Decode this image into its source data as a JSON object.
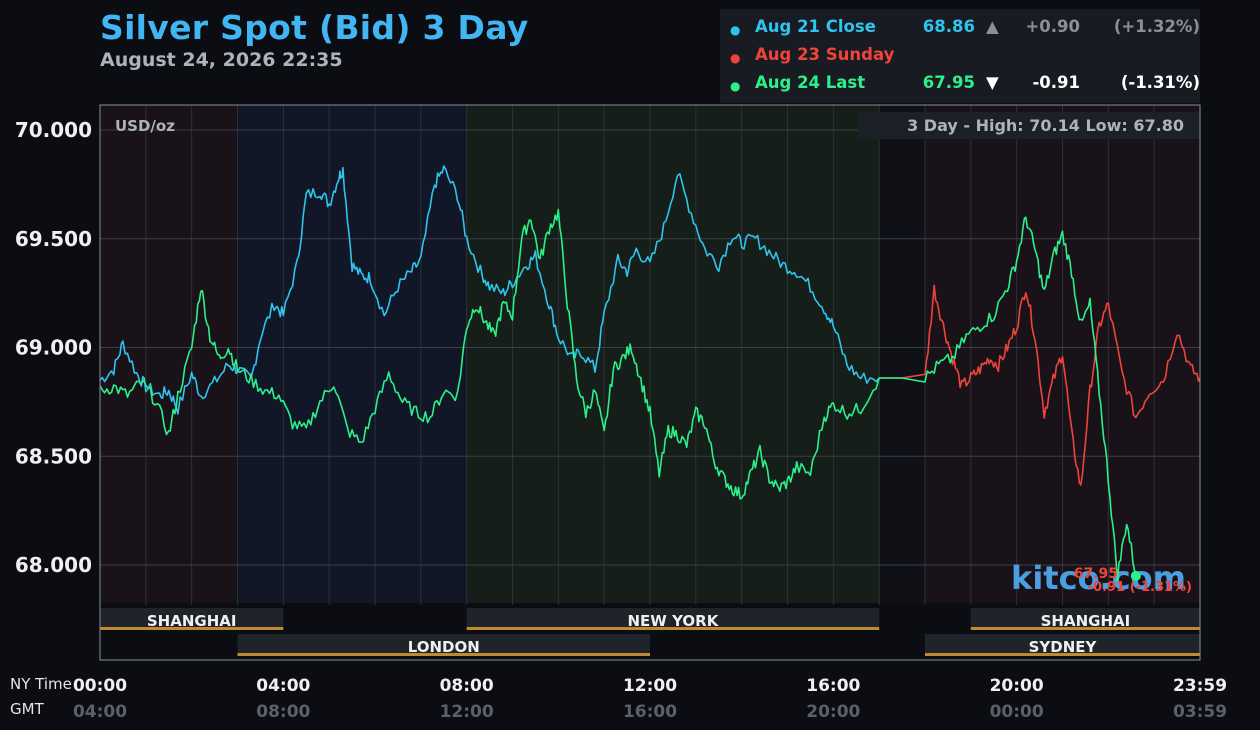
{
  "header": {
    "title": "Silver Spot (Bid) 3 Day",
    "timestamp": "August 24, 2026 22:35"
  },
  "legend": [
    {
      "label": "Aug 21 Close",
      "value": "68.86",
      "arrow": "▲",
      "change": "+0.90",
      "percent": "(+1.32%)",
      "color": "#2ec4ee"
    },
    {
      "label": "Aug 23 Sunday",
      "value": "",
      "arrow": "",
      "change": "",
      "percent": "",
      "color": "#f0443a"
    },
    {
      "label": "Aug 24 Last",
      "value": "67.95",
      "arrow": "▼",
      "change": "-0.91",
      "percent": "(-1.31%)",
      "color": "#2cf08a"
    }
  ],
  "chart": {
    "unit_label": "USD/oz",
    "range_label": "3 Day - High: 70.14  Low: 67.80",
    "watermark": "kitco.com",
    "last_value_label": "67.95",
    "last_change_label": "-0.91 (-1.31%)",
    "time_axis_label_ny": "NY Time",
    "time_axis_label_gmt": "GMT"
  },
  "chart_data": {
    "type": "line",
    "title": "Silver Spot (Bid) 3 Day",
    "ylabel": "USD/oz",
    "ylim": [
      67.8,
      70.2
    ],
    "y_ticks": [
      70.0,
      69.5,
      69.0,
      68.5,
      68.0
    ],
    "y_tick_labels": [
      "70.000",
      "69.500",
      "69.000",
      "68.500",
      "68.000"
    ],
    "x_range_hours": [
      0,
      24
    ],
    "x_ticks": [
      {
        "hour": 0,
        "ny": "00:00",
        "gmt": "04:00"
      },
      {
        "hour": 4,
        "ny": "04:00",
        "gmt": "08:00"
      },
      {
        "hour": 8,
        "ny": "08:00",
        "gmt": "12:00"
      },
      {
        "hour": 12,
        "ny": "12:00",
        "gmt": "16:00"
      },
      {
        "hour": 16,
        "ny": "16:00",
        "gmt": "20:00"
      },
      {
        "hour": 20,
        "ny": "20:00",
        "gmt": "00:00"
      },
      {
        "hour": 24,
        "ny": "23:59",
        "gmt": "03:59"
      }
    ],
    "sessions": [
      {
        "name": "SHANGHAI",
        "start": 0,
        "end": 4,
        "row": 1
      },
      {
        "name": "NEW YORK",
        "start": 8,
        "end": 17,
        "row": 1
      },
      {
        "name": "SHANGHAI",
        "start": 19,
        "end": 24,
        "row": 1
      },
      {
        "name": "LONDON",
        "start": 3,
        "end": 12,
        "row": 2
      },
      {
        "name": "SYDNEY",
        "start": 18,
        "end": 24,
        "row": 2
      }
    ],
    "grid": true,
    "series": [
      {
        "name": "Aug 21 Close",
        "color": "#2ec4ee",
        "x": [
          0,
          0.3,
          0.5,
          0.8,
          1.0,
          1.3,
          1.5,
          1.7,
          2.0,
          2.2,
          2.5,
          2.8,
          3.0,
          3.3,
          3.5,
          3.8,
          4.0,
          4.3,
          4.5,
          4.8,
          5.0,
          5.2,
          5.3,
          5.5,
          5.7,
          5.9,
          6.2,
          6.5,
          6.8,
          7.0,
          7.3,
          7.5,
          7.8,
          8.0,
          8.3,
          8.5,
          8.8,
          9.0,
          9.3,
          9.5,
          9.8,
          10.0,
          10.3,
          10.5,
          10.8,
          11.0,
          11.3,
          11.5,
          11.7,
          12.0,
          12.3,
          12.6,
          12.9,
          13.2,
          13.5,
          13.8,
          14.0,
          14.3,
          14.6,
          14.9,
          15.2,
          15.5,
          15.8,
          16.0,
          16.3,
          16.6,
          17.0
        ],
        "values": [
          68.85,
          68.9,
          69.02,
          68.88,
          68.82,
          68.78,
          68.8,
          68.72,
          68.88,
          68.78,
          68.84,
          68.92,
          68.9,
          68.85,
          69.05,
          69.2,
          69.15,
          69.38,
          69.7,
          69.72,
          69.66,
          69.78,
          69.82,
          69.38,
          69.33,
          69.32,
          69.15,
          69.28,
          69.35,
          69.4,
          69.75,
          69.82,
          69.7,
          69.5,
          69.35,
          69.28,
          69.25,
          69.3,
          69.38,
          69.42,
          69.2,
          69.05,
          68.95,
          68.98,
          68.9,
          69.15,
          69.4,
          69.35,
          69.45,
          69.38,
          69.55,
          69.8,
          69.62,
          69.45,
          69.38,
          69.52,
          69.48,
          69.5,
          69.44,
          69.38,
          69.35,
          69.28,
          69.18,
          69.1,
          68.92,
          68.86,
          68.86
        ]
      },
      {
        "name": "Aug 23 Sunday",
        "color": "#f0443a",
        "x": [
          17.0,
          18.0,
          18.2,
          18.4,
          18.6,
          18.8,
          19.0,
          19.2,
          19.4,
          19.6,
          19.8,
          20.0,
          20.2,
          20.4,
          20.6,
          20.8,
          21.0,
          21.2,
          21.4,
          21.6,
          21.8,
          22.0,
          22.3,
          22.6,
          22.9,
          23.2,
          23.5,
          23.8,
          24.0
        ],
        "values": [
          68.86,
          68.86,
          69.27,
          69.1,
          68.95,
          68.82,
          68.86,
          68.9,
          68.95,
          68.92,
          69.0,
          69.1,
          69.28,
          69.05,
          68.7,
          68.85,
          68.98,
          68.6,
          68.35,
          68.8,
          69.1,
          69.2,
          68.88,
          68.68,
          68.8,
          68.85,
          69.08,
          68.9,
          68.86
        ]
      },
      {
        "name": "Aug 24 Last",
        "color": "#2cf08a",
        "x": [
          0,
          0.3,
          0.6,
          0.9,
          1.2,
          1.5,
          1.7,
          2.0,
          2.2,
          2.4,
          2.6,
          2.8,
          3.0,
          3.3,
          3.6,
          3.9,
          4.2,
          4.5,
          4.8,
          5.1,
          5.4,
          5.7,
          6.0,
          6.3,
          6.6,
          6.9,
          7.2,
          7.5,
          7.8,
          8.0,
          8.2,
          8.4,
          8.6,
          8.8,
          9.0,
          9.2,
          9.4,
          9.6,
          9.8,
          10.0,
          10.2,
          10.4,
          10.6,
          10.8,
          11.0,
          11.2,
          11.4,
          11.6,
          11.8,
          12.0,
          12.2,
          12.4,
          12.6,
          12.8,
          13.0,
          13.2,
          13.4,
          13.6,
          13.8,
          14.0,
          14.2,
          14.4,
          14.6,
          14.8,
          15.0,
          15.2,
          15.5,
          15.8,
          16.0,
          16.3,
          16.6,
          17.0,
          18.0,
          18.3,
          18.6,
          18.9,
          19.2,
          19.5,
          19.8,
          20.0,
          20.2,
          20.4,
          20.6,
          20.8,
          21.0,
          21.2,
          21.4,
          21.6,
          21.8,
          22.0,
          22.2,
          22.4,
          22.6
        ],
        "values": [
          68.8,
          68.82,
          68.78,
          68.84,
          68.76,
          68.6,
          68.78,
          69.0,
          69.28,
          69.05,
          68.95,
          69.0,
          68.9,
          68.85,
          68.8,
          68.78,
          68.65,
          68.62,
          68.75,
          68.84,
          68.62,
          68.56,
          68.72,
          68.88,
          68.75,
          68.7,
          68.68,
          68.8,
          68.78,
          69.1,
          69.2,
          69.12,
          69.05,
          69.2,
          69.15,
          69.5,
          69.6,
          69.4,
          69.55,
          69.62,
          69.2,
          68.85,
          68.7,
          68.8,
          68.6,
          68.9,
          68.95,
          69.0,
          68.85,
          68.7,
          68.42,
          68.62,
          68.6,
          68.55,
          68.7,
          68.65,
          68.48,
          68.4,
          68.35,
          68.32,
          68.42,
          68.52,
          68.4,
          68.35,
          68.38,
          68.45,
          68.42,
          68.68,
          68.74,
          68.7,
          68.72,
          68.86,
          68.86,
          68.92,
          68.95,
          69.05,
          69.1,
          69.15,
          69.28,
          69.4,
          69.6,
          69.45,
          69.25,
          69.42,
          69.52,
          69.35,
          69.1,
          69.2,
          68.8,
          68.4,
          67.95,
          68.2,
          67.95
        ]
      }
    ]
  }
}
